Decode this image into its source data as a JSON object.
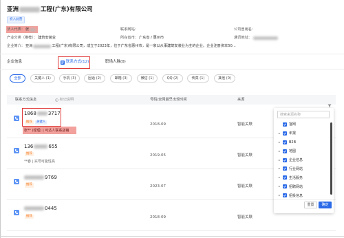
{
  "company": {
    "name_head": "亚洲",
    "name_tail": "工程(广东)有限公司",
    "badge": "初入此营"
  },
  "info": {
    "legal_rep": {
      "label": "法人代表：",
      "value": "张"
    },
    "website": {
      "label": "联系网站："
    },
    "former_name": {
      "label": "公司曾用名："
    },
    "industry": {
      "label": "产业分类（推荐）：",
      "value": "建筑安装业"
    },
    "location": {
      "label": "所在省市：",
      "value": "广东省 / 惠州市"
    },
    "address": {
      "label": "通讯地址："
    },
    "intro": {
      "label": "企业简介：",
      "head": "亚洲",
      "tail": "工程(广东)有限公司，成立于2023年，位于广东省惠州市，是一家以从事建筑安装业为主的企业。企业注册资本50..."
    }
  },
  "tabs": [
    {
      "label": "企业信息",
      "active": false
    },
    {
      "label": "联系方式(12)",
      "active": true
    },
    {
      "label": "职场人脉(0)",
      "active": false
    }
  ],
  "filters": [
    {
      "label": "全部",
      "active": true
    },
    {
      "label": "关键人 (1)",
      "active": false
    },
    {
      "label": "手机 (3)",
      "active": false
    },
    {
      "label": "固话 (2)",
      "active": false
    },
    {
      "label": "邮箱 (3)",
      "active": false
    },
    {
      "label": "微信 (1)",
      "active": false
    },
    {
      "label": "QQ (2)",
      "active": false
    },
    {
      "label": "传真 (1)",
      "active": false
    },
    {
      "label": "其他 (0)",
      "active": false
    }
  ],
  "table": {
    "col_contact": "联系方式信息",
    "mark_help": "标记说明",
    "col_date": "号码/全网最早出现时间",
    "col_source": "来源"
  },
  "rows": [
    {
      "number_head": "1868",
      "number_tail": "3717",
      "tags": [
        "推荐",
        "关键人"
      ],
      "note": "张** (经理) | 可达人联系店铺",
      "date": "2018-09",
      "source": "智能关联"
    },
    {
      "number_head": "136",
      "number_tail": "655",
      "tags": [
        "推荐"
      ],
      "note": "**春 | 实号可能性高",
      "date": "2019-05",
      "source": "智能关联"
    },
    {
      "number_tail": "9769",
      "tags": [
        "推荐"
      ],
      "date": "2023-07",
      "source": "智能关联"
    },
    {
      "number_tail": "0445",
      "tags": [
        "推荐"
      ],
      "date": "2018-09",
      "source": "智能关联"
    }
  ],
  "source_panel": {
    "search_placeholder": "搜索来源名称",
    "items": [
      {
        "label": "官网",
        "checked": true,
        "expandable": false
      },
      {
        "label": "年报",
        "checked": true,
        "expandable": true
      },
      {
        "label": "B2B",
        "checked": true,
        "expandable": true
      },
      {
        "label": "地图",
        "checked": true,
        "expandable": true
      },
      {
        "label": "企业信息",
        "checked": true,
        "expandable": true
      },
      {
        "label": "行业网站",
        "checked": true,
        "expandable": true
      },
      {
        "label": "生活服务",
        "checked": true,
        "expandable": true
      },
      {
        "label": "招聘网站",
        "checked": true,
        "expandable": true
      },
      {
        "label": "招投信息",
        "checked": true,
        "expandable": true
      }
    ],
    "reset_label": "重置",
    "confirm_label": "确定"
  },
  "icons": {
    "tab_contact": "contact-card-icon",
    "mark_help": "help-circle-icon",
    "source_filter": "filter-icon",
    "row_contact": "phone-icon",
    "checkbox": "checkbox-checked-icon",
    "expand": "caret-right-icon"
  },
  "colors": {
    "accent": "#2a6ae8",
    "annotation": "#e03a3a",
    "highlight": "#f2a19c",
    "recommend": "#f5761a"
  }
}
